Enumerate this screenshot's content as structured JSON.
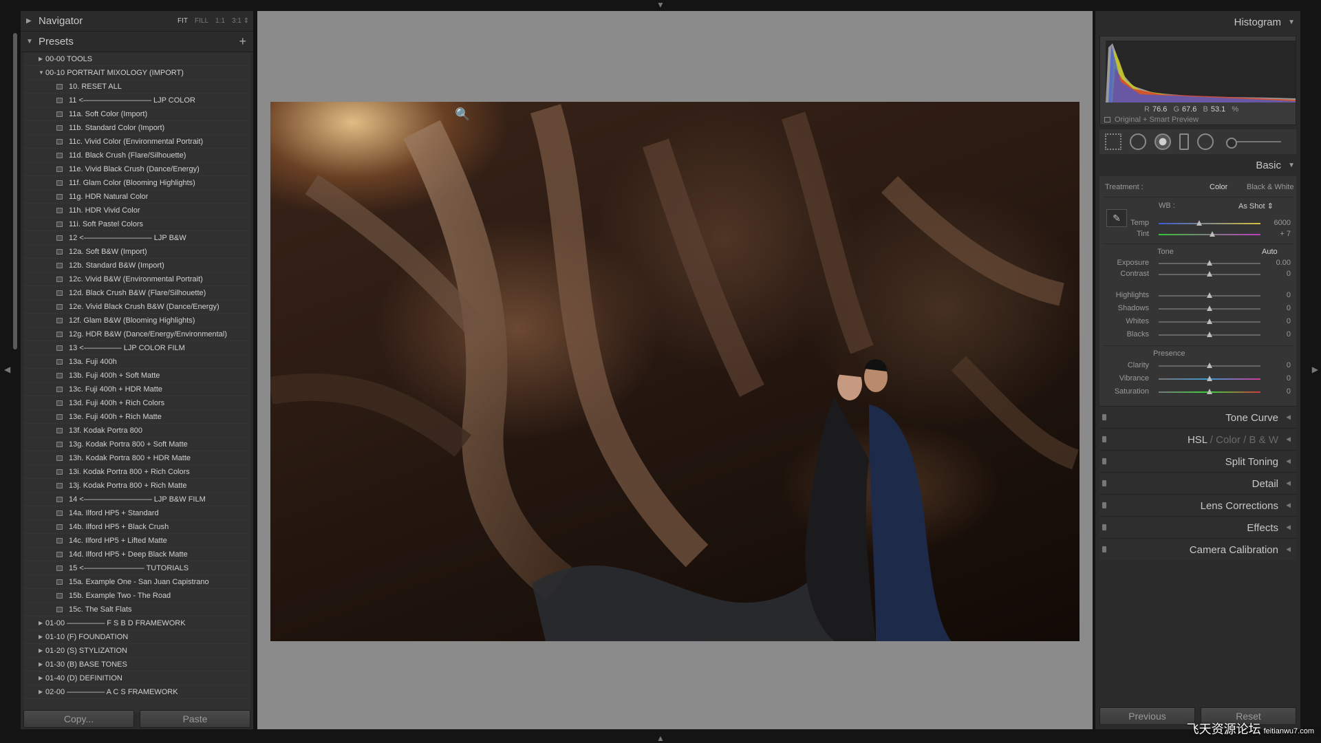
{
  "navigator": {
    "title": "Navigator",
    "zoom_options": [
      "FIT",
      "FILL",
      "1:1",
      "3:1 ⇕"
    ]
  },
  "presets": {
    "title": "Presets",
    "add_label": "+",
    "rows": [
      {
        "type": "folder",
        "expanded": false,
        "label": "00-00 TOOLS"
      },
      {
        "type": "folder",
        "expanded": true,
        "label": "00-10 PORTRAIT MIXOLOGY (IMPORT)"
      },
      {
        "type": "item",
        "label": "10. RESET ALL"
      },
      {
        "type": "item",
        "label": "11 <————————— LJP COLOR"
      },
      {
        "type": "item",
        "label": "11a. Soft Color (Import)"
      },
      {
        "type": "item",
        "label": "11b. Standard Color (Import)"
      },
      {
        "type": "item",
        "label": "11c. Vivid Color (Environmental Portrait)"
      },
      {
        "type": "item",
        "label": "11d. Black Crush (Flare/Silhouette)"
      },
      {
        "type": "item",
        "label": "11e. Vivid Black Crush (Dance/Energy)"
      },
      {
        "type": "item",
        "label": "11f. Glam Color (Blooming Highlights)"
      },
      {
        "type": "item",
        "label": "11g. HDR Natural Color"
      },
      {
        "type": "item",
        "label": "11h. HDR Vivid Color"
      },
      {
        "type": "item",
        "label": "11i. Soft Pastel Colors"
      },
      {
        "type": "item",
        "label": "12 <————————— LJP B&W"
      },
      {
        "type": "item",
        "label": "12a. Soft B&W (Import)"
      },
      {
        "type": "item",
        "label": "12b. Standard B&W (Import)"
      },
      {
        "type": "item",
        "label": "12c. Vivid B&W (Environmental Portrait)"
      },
      {
        "type": "item",
        "label": "12d. Black Crush B&W (Flare/Silhouette)"
      },
      {
        "type": "item",
        "label": "12e. Vivid Black Crush B&W (Dance/Energy)"
      },
      {
        "type": "item",
        "label": "12f. Glam B&W (Blooming Highlights)"
      },
      {
        "type": "item",
        "label": "12g. HDR B&W (Dance/Energy/Environmental)"
      },
      {
        "type": "item",
        "label": "13 <————— LJP COLOR FILM"
      },
      {
        "type": "item",
        "label": "13a. Fuji 400h"
      },
      {
        "type": "item",
        "label": "13b. Fuji 400h + Soft Matte"
      },
      {
        "type": "item",
        "label": "13c. Fuji 400h + HDR Matte"
      },
      {
        "type": "item",
        "label": "13d. Fuji 400h + Rich Colors"
      },
      {
        "type": "item",
        "label": "13e. Fuji 400h + Rich Matte"
      },
      {
        "type": "item",
        "label": "13f. Kodak Portra 800"
      },
      {
        "type": "item",
        "label": "13g. Kodak Portra 800 + Soft Matte"
      },
      {
        "type": "item",
        "label": "13h. Kodak Portra 800 + HDR Matte"
      },
      {
        "type": "item",
        "label": "13i. Kodak Portra 800 + Rich Colors"
      },
      {
        "type": "item",
        "label": "13j. Kodak Portra 800 + Rich Matte"
      },
      {
        "type": "item",
        "label": "14 <————————— LJP B&W FILM"
      },
      {
        "type": "item",
        "label": "14a. Ilford HP5 + Standard"
      },
      {
        "type": "item",
        "label": "14b. Ilford HP5 + Black Crush"
      },
      {
        "type": "item",
        "label": "14c. Ilford HP5 + Lifted Matte"
      },
      {
        "type": "item",
        "label": "14d. Ilford HP5 + Deep Black Matte"
      },
      {
        "type": "item",
        "label": "15 <———————— TUTORIALS"
      },
      {
        "type": "item",
        "label": "15a. Example One - San Juan Capistrano"
      },
      {
        "type": "item",
        "label": "15b. Example Two - The Road"
      },
      {
        "type": "item",
        "label": "15c. The Salt Flats"
      },
      {
        "type": "folder",
        "expanded": false,
        "label": "01-00 ————— F S B D FRAMEWORK"
      },
      {
        "type": "folder",
        "expanded": false,
        "label": "01-10 (F) FOUNDATION"
      },
      {
        "type": "folder",
        "expanded": false,
        "label": "01-20 (S) STYLIZATION"
      },
      {
        "type": "folder",
        "expanded": false,
        "label": "01-30 (B) BASE TONES"
      },
      {
        "type": "folder",
        "expanded": false,
        "label": "01-40 (D) DEFINITION"
      },
      {
        "type": "folder",
        "expanded": false,
        "label": "02-00 ————— A C S FRAMEWORK"
      }
    ]
  },
  "left_buttons": {
    "copy": "Copy...",
    "paste": "Paste"
  },
  "histogram": {
    "title": "Histogram",
    "r_label": "R",
    "r": "76.6",
    "g_label": "G",
    "g": "67.6",
    "b_label": "B",
    "b": "53.1",
    "unit": "%",
    "preview_label": "Original + Smart Preview"
  },
  "basic": {
    "title": "Basic",
    "treatment_label": "Treatment :",
    "treatment_color": "Color",
    "treatment_bw": "Black & White",
    "wb_label": "WB :",
    "wb_value": "As Shot ⇕",
    "tone_label": "Tone",
    "auto_label": "Auto",
    "presence_label": "Presence",
    "sliders": {
      "temp": {
        "label": "Temp",
        "value": "6000",
        "pos": 0.4
      },
      "tint": {
        "label": "Tint",
        "value": "+ 7",
        "pos": 0.53
      },
      "exposure": {
        "label": "Exposure",
        "value": "0.00",
        "pos": 0.5
      },
      "contrast": {
        "label": "Contrast",
        "value": "0",
        "pos": 0.5
      },
      "highlights": {
        "label": "Highlights",
        "value": "0",
        "pos": 0.5
      },
      "shadows": {
        "label": "Shadows",
        "value": "0",
        "pos": 0.5
      },
      "whites": {
        "label": "Whites",
        "value": "0",
        "pos": 0.5
      },
      "blacks": {
        "label": "Blacks",
        "value": "0",
        "pos": 0.5
      },
      "clarity": {
        "label": "Clarity",
        "value": "0",
        "pos": 0.5
      },
      "vibrance": {
        "label": "Vibrance",
        "value": "0",
        "pos": 0.5
      },
      "saturation": {
        "label": "Saturation",
        "value": "0",
        "pos": 0.5
      }
    }
  },
  "panels": {
    "tone_curve": "Tone Curve",
    "hsl": "HSL",
    "hsl_slash": "/",
    "hsl_color": "Color",
    "hsl_bw": "B & W",
    "split_toning": "Split Toning",
    "detail": "Detail",
    "lens_corrections": "Lens Corrections",
    "effects": "Effects",
    "camera_calibration": "Camera Calibration"
  },
  "right_buttons": {
    "previous": "Previous",
    "reset": "Reset"
  },
  "watermark": {
    "text": "飞天资源论坛",
    "url": "feitianwu7.com"
  }
}
